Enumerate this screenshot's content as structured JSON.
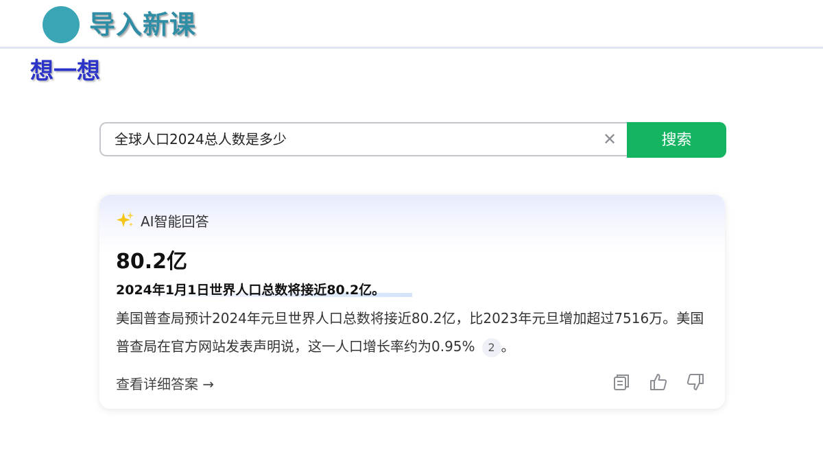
{
  "header": {
    "title": "导入新课"
  },
  "section": {
    "title": "想一想"
  },
  "search": {
    "query": "全球人口2024总人数是多少",
    "clear_icon": "close-icon",
    "button_label": "搜索",
    "button_color": "#14b463"
  },
  "answer_card": {
    "badge_icon": "sparkle-icon",
    "badge_label": "AI智能回答",
    "headline": "80.2亿",
    "summary": "2024年1月1日世界人口总数将接近80.2亿。",
    "body_text": "美国普查局预计2024年元旦世界人口总数将接近80.2亿，比2023年元旦增加超过7516万。美国普查局在官方网站发表声明说，这一人口增长率约为0.95%",
    "citation": "2",
    "body_end": "。",
    "detail_link": "查看详细答案 →",
    "actions": [
      "copy-icon",
      "thumbs-up-icon",
      "thumbs-down-icon"
    ]
  }
}
